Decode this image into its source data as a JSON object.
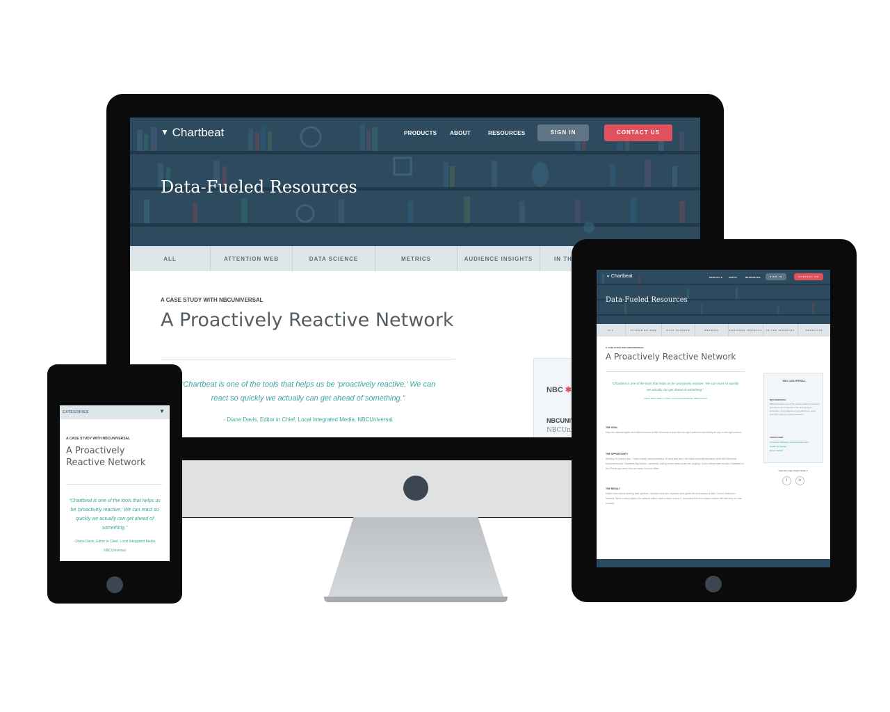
{
  "brand": {
    "name": "Chartbeat"
  },
  "nav": {
    "products": "PRODUCTS",
    "about": "ABOUT",
    "resources": "RESOURCES",
    "sign_in": "SIGN IN",
    "contact_us": "CONTACT US"
  },
  "hero": {
    "title": "Data-Fueled Resources"
  },
  "categories": {
    "all": "ALL",
    "attention_web": "ATTENTION WEB",
    "data_science": "DATA SCIENCE",
    "metrics": "METRICS",
    "audience_insights": "AUDIENCE INSIGHTS",
    "in_the_industry": "IN THE INDUSTRY",
    "in_the_truncated": "IN THE",
    "products": "PRODUCTS",
    "mobile_label": "CATEGORIES"
  },
  "article": {
    "eyebrow": "A CASE STUDY WITH NBCUNIVERSAL",
    "title": "A Proactively Reactive Network",
    "quote": "Chartbeat is one of the tools that helps us be ‘proactively reactive.’ We can react so quickly we actually can get ahead of something.",
    "quote_desktop_line1": "“Chartbeat is one of the tools that helps us be ‘proactively reactive.’ We can",
    "quote_desktop_line2": "react so quickly we actually can get ahead of something.”",
    "quote_mobile": "“Chartbeat is one of the tools that helps us be ‘proactively reactive.’ We can react so quickly we actually can get ahead of something.”",
    "attribution": "- Diane Davis, Editor in Chief, Local Integrated Media, NBCUniversal",
    "sections": [
      {
        "heading": "THE GOAL",
        "body": "Help the national digital and editorial teams at NBCUniversal ensure that the right audience was finding its way to the right content."
      },
      {
        "heading": "THE OPPORTUNITY",
        "body": "Working 24 hours a day, 7 days a week, and overseeing 10 local web sites, the digital and editorial teams at all NBCUniversal locations monitor Chartbeat Big Boards, constantly looking to see what stories are popping. Some editors even monitor Chartbeat on the iPhone app when they are away from the office."
      },
      {
        "heading": "THE RESULT",
        "body": "Rather than editors sharing their opinions, real-time data and objective facts guide the discussions at NBC Owned Television Stations. When a story spikes, the national editors take a closer look at it, and match the best related content with the story for that moment."
      }
    ]
  },
  "sidebar": {
    "logo_text": "NBC UNIVERSAL",
    "logo_text_desktop": "NBC",
    "company_heading": "NBCUNIVERSAL",
    "company_heading_desktop": "NBCUNIV",
    "company_sub_desktop": "NBCUniv",
    "company_desc": "NBCUniversal is one of the world's leading media and entertainment companies in the development, production, and marketing of entertainment, news, and information to a global audience.",
    "tools_heading": "TOOLS USED",
    "tools": [
      "Chartbeat Publishing: Editorial Dashboard",
      "Heads Up Display",
      "Report Builder"
    ],
    "share_prompt": "Liked this Case Study? Share it.",
    "share": [
      "twitter-icon",
      "linkedin-icon"
    ]
  },
  "colors": {
    "hero_bg": "#2d4a5f",
    "accent_teal": "#3aa59a",
    "contact_red": "#e0515d",
    "signin_gray": "#5f7484",
    "category_bar": "#dfe6ea"
  }
}
